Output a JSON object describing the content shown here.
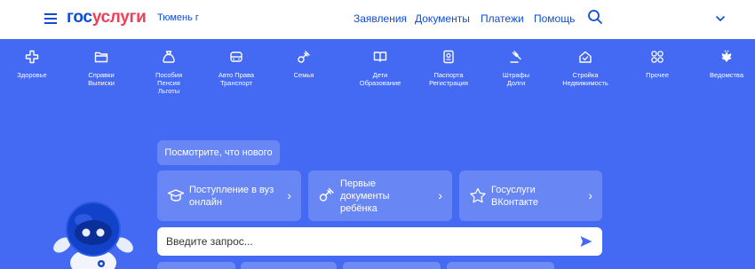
{
  "header": {
    "logo_part1": "гос",
    "logo_part2": "услуги",
    "region": "Тюмень г",
    "nav": [
      "Заявления",
      "Документы",
      "Платежи",
      "Помощь"
    ]
  },
  "categories": [
    {
      "label": "Здоровье",
      "icon": "health-plus-icon"
    },
    {
      "label": "Справки\nВыписки",
      "icon": "folder-icon"
    },
    {
      "label": "Пособия\nПенсия\nЛьготы",
      "icon": "money-bag-icon"
    },
    {
      "label": "Авто Права\nТранспорт",
      "icon": "car-icon"
    },
    {
      "label": "Семья",
      "icon": "pacifier-icon"
    },
    {
      "label": "Дети\nОбразование",
      "icon": "book-icon"
    },
    {
      "label": "Паспорта\nРегистрация",
      "icon": "passport-icon"
    },
    {
      "label": "Штрафы\nДолги",
      "icon": "gavel-icon"
    },
    {
      "label": "Стройка\nНедвижимость",
      "icon": "house-icon"
    },
    {
      "label": "Прочее",
      "icon": "grid-icon"
    },
    {
      "label": "Ведомства",
      "icon": "coat-of-arms-icon"
    }
  ],
  "whatsnew": "Посмотрите, что нового",
  "cards": [
    {
      "label": "Поступление в вуз\nонлайн",
      "icon": "graduation-cap-icon"
    },
    {
      "label": "Первые\nдокументы\nребёнка",
      "icon": "pacifier-icon"
    },
    {
      "label": "Госуслуги\nВКонтакте",
      "icon": "star-icon"
    }
  ],
  "search": {
    "placeholder": "Введите запрос..."
  },
  "colors": {
    "brand_blue": "#0d4cd3",
    "brand_red": "#ee3f58",
    "hero_bg": "#4469f2"
  }
}
